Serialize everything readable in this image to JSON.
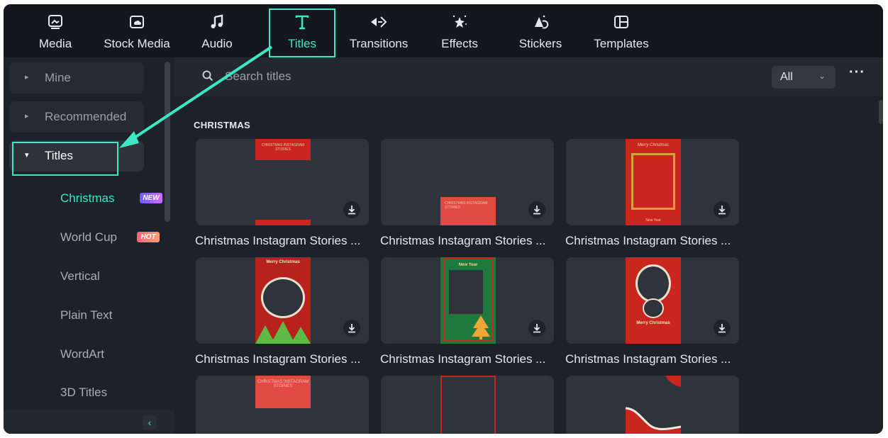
{
  "toolbar": {
    "items": [
      {
        "label": "Media",
        "icon": "media-icon"
      },
      {
        "label": "Stock Media",
        "icon": "stock-media-icon"
      },
      {
        "label": "Audio",
        "icon": "music-note-icon"
      },
      {
        "label": "Titles",
        "icon": "text-t-icon",
        "active": true
      },
      {
        "label": "Transitions",
        "icon": "transitions-icon"
      },
      {
        "label": "Effects",
        "icon": "effects-star-icon"
      },
      {
        "label": "Stickers",
        "icon": "stickers-icon"
      },
      {
        "label": "Templates",
        "icon": "templates-icon"
      }
    ]
  },
  "sidebar": {
    "groups": [
      {
        "label": "Mine",
        "expanded": false
      },
      {
        "label": "Recommended",
        "expanded": false
      },
      {
        "label": "Titles",
        "expanded": true
      }
    ],
    "subitems": [
      {
        "label": "Christmas",
        "active": true,
        "badge": "NEW"
      },
      {
        "label": "World Cup",
        "badge": "HOT"
      },
      {
        "label": "Vertical"
      },
      {
        "label": "Plain Text"
      },
      {
        "label": "WordArt"
      },
      {
        "label": "3D Titles"
      }
    ]
  },
  "search": {
    "placeholder": "Search titles",
    "value": ""
  },
  "filter": {
    "value": "All"
  },
  "section_title": "CHRISTMAS",
  "cards": [
    {
      "label": "Christmas Instagram Stories ..."
    },
    {
      "label": "Christmas Instagram Stories ..."
    },
    {
      "label": "Christmas Instagram Stories ..."
    },
    {
      "label": "Christmas Instagram Stories ..."
    },
    {
      "label": "Christmas Instagram Stories ..."
    },
    {
      "label": "Christmas Instagram Stories ..."
    },
    {
      "label": ""
    },
    {
      "label": ""
    },
    {
      "label": ""
    }
  ],
  "thumb_text": {
    "c1": "CHRISTMAS INSTAGRAM STORIES",
    "c2": "CHRISTMAS INSTAGRAM STORIES",
    "c3_top": "Merry Christmas",
    "c3_bottom": "New Year",
    "c4": "Merry Christmas",
    "c5": "New Year",
    "c6": "Merry Christmas",
    "c7": "CHRISTMAS INSTAGRAM STORIES"
  },
  "colors": {
    "accent": "#3ee6c4",
    "panel": "#1d2129",
    "thumb_red": "#c8261f"
  }
}
